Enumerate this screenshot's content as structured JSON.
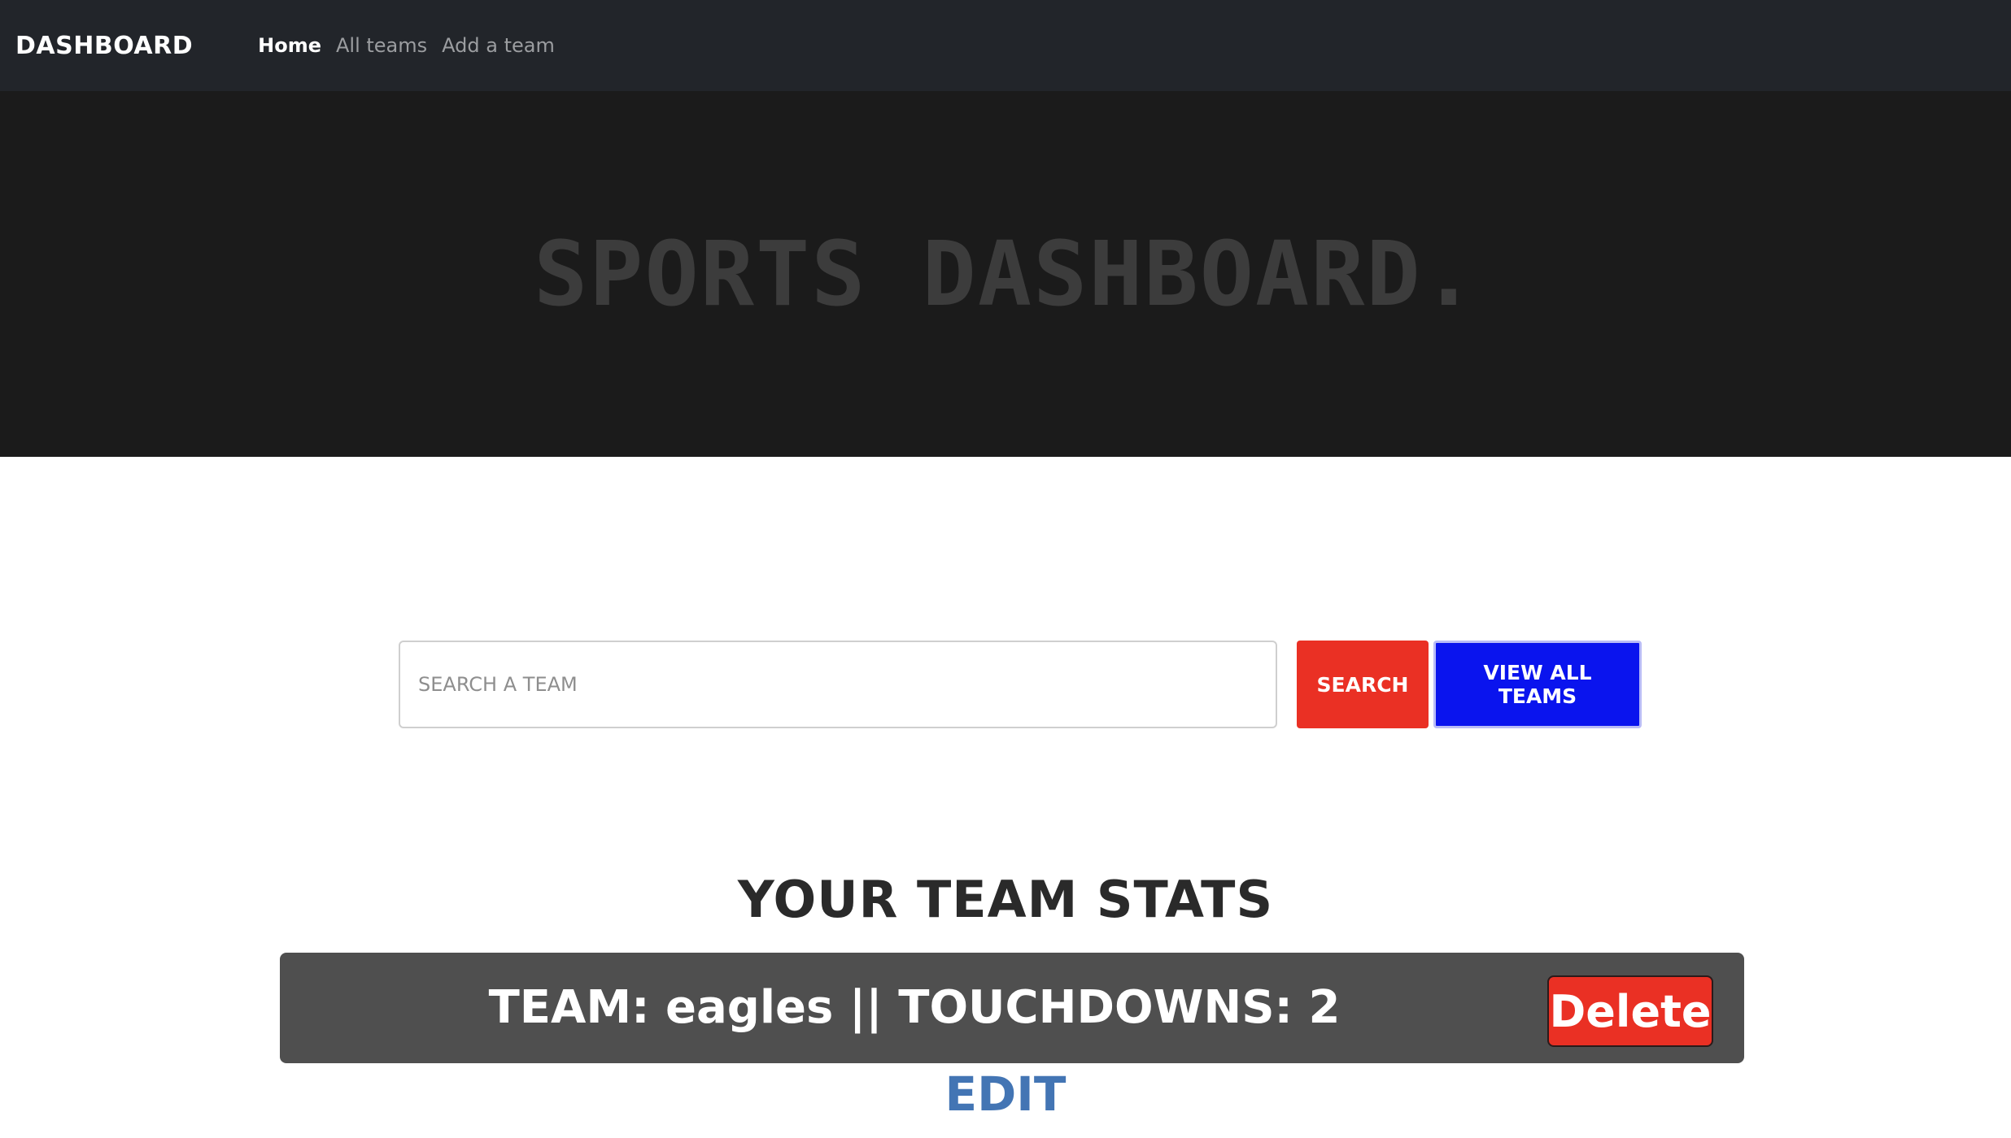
{
  "navbar": {
    "brand": "DASHBOARD",
    "links": [
      {
        "label": "Home",
        "active": true
      },
      {
        "label": "All teams",
        "active": false
      },
      {
        "label": "Add a team",
        "active": false
      }
    ]
  },
  "hero": {
    "title": "SPORTS DASHBOARD."
  },
  "search": {
    "placeholder": "SEARCH A TEAM",
    "value": "",
    "search_button": "SEARCH",
    "view_all_button": "VIEW ALL TEAMS"
  },
  "stats": {
    "title": "YOUR TEAM STATS",
    "teams": [
      {
        "summary": "TEAM: eagles || TOUCHDOWNS: 2",
        "delete_label": "Delete",
        "edit_label": "EDIT"
      }
    ]
  },
  "colors": {
    "navbar_bg": "#22252a",
    "hero_bg": "#1b1b1b",
    "search_button": "#ea3024",
    "view_all_button": "#0a14ee",
    "team_card_bg": "#4f4f4f",
    "delete_button": "#ea3024",
    "edit_link": "#4375b4"
  }
}
